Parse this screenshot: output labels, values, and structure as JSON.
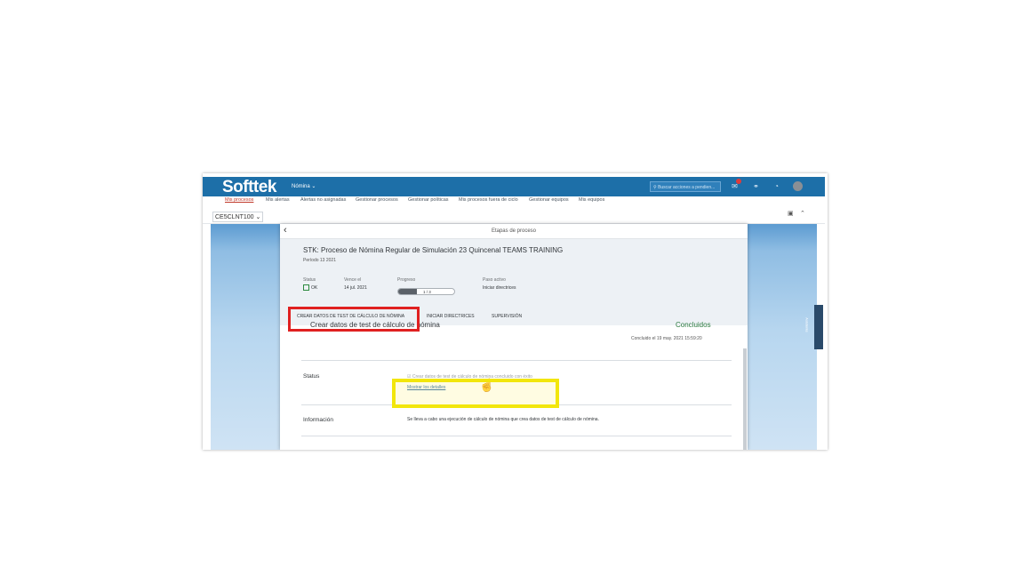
{
  "shell": {
    "logo": "Softtek",
    "app_menu": "Nómina ⌄",
    "search_placeholder": "Buscar acciones a pendien..."
  },
  "nav": {
    "items": [
      {
        "label": "Mis procesos",
        "active": true
      },
      {
        "label": "Mis alertas"
      },
      {
        "label": "Alertas no asignadas"
      },
      {
        "label": "Gestionar procesos"
      },
      {
        "label": "Gestionar políticas"
      },
      {
        "label": "Mis procesos fuera de ciclo"
      },
      {
        "label": "Gestionar equipos"
      },
      {
        "label": "Mis equipos"
      }
    ]
  },
  "toolbar": {
    "client": "CE5CLNT100 ⌄"
  },
  "dialog": {
    "title": "Etapas de proceso",
    "process_title": "STK: Proceso de Nómina Regular de Simulación 23 Quincenal TEAMS TRAINING",
    "period": "Período 13 2021",
    "attributes": {
      "status_label": "Status",
      "status_value": "OK",
      "due_label": "Vence el",
      "due_value": "14 jul. 2021",
      "progress_label": "Progreso",
      "progress_text": "1 / 3",
      "progress_fraction": 0.33,
      "active_step_label": "Paso activo",
      "active_step_value": "Iniciar directrices"
    },
    "tabs": [
      {
        "label": "CREAR DATOS DE TEST DE CÁLCULO DE NÓMINA"
      },
      {
        "label": "INICIAR DIRECTRICES"
      },
      {
        "label": "SUPERVISIÓN"
      }
    ],
    "section": {
      "heading": "Crear datos de test de cálculo de nómina",
      "status": "Concluidos",
      "concluded": "Concluido el 19 may. 2021 15:59:20",
      "status_row_label": "Status",
      "status_row_value": "☑ Crear datos de test de cálculo de nómina concluido con éxito",
      "details_link": "Mostrar los detalles",
      "info_row_label": "Información",
      "info_row_value": "Se lleva a cabo una ejecución de cálculo de nómina que crea datos de test de cálculo de nómina."
    }
  },
  "side_tab": "Asistente"
}
